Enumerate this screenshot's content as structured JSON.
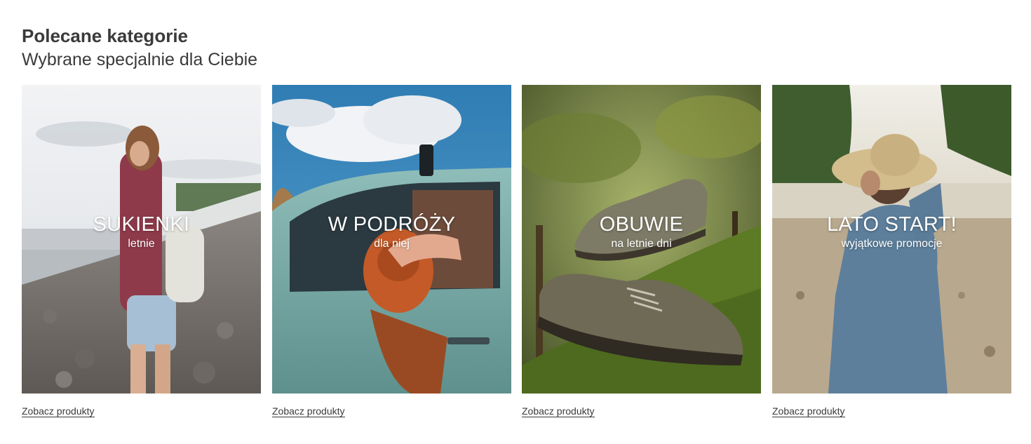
{
  "section": {
    "title": "Polecane kategorie",
    "subtitle": "Wybrane specjalnie dla Ciebie"
  },
  "cards": [
    {
      "title": "SUKIENKI",
      "subtitle": "letnie",
      "link": "Zobacz produkty",
      "image": "photo-woman-backpack-riverbank"
    },
    {
      "title": "W PODRÓŻY",
      "subtitle": "dla niej",
      "link": "Zobacz produkty",
      "image": "photo-woman-hat-car-window"
    },
    {
      "title": "OBUWIE",
      "subtitle": "na letnie dni",
      "link": "Zobacz produkty",
      "image": "photo-leather-shoes-moss"
    },
    {
      "title": "LATO START!",
      "subtitle": "wyjątkowe promocje",
      "link": "Zobacz produkty",
      "image": "photo-woman-straw-hat-beach"
    }
  ]
}
